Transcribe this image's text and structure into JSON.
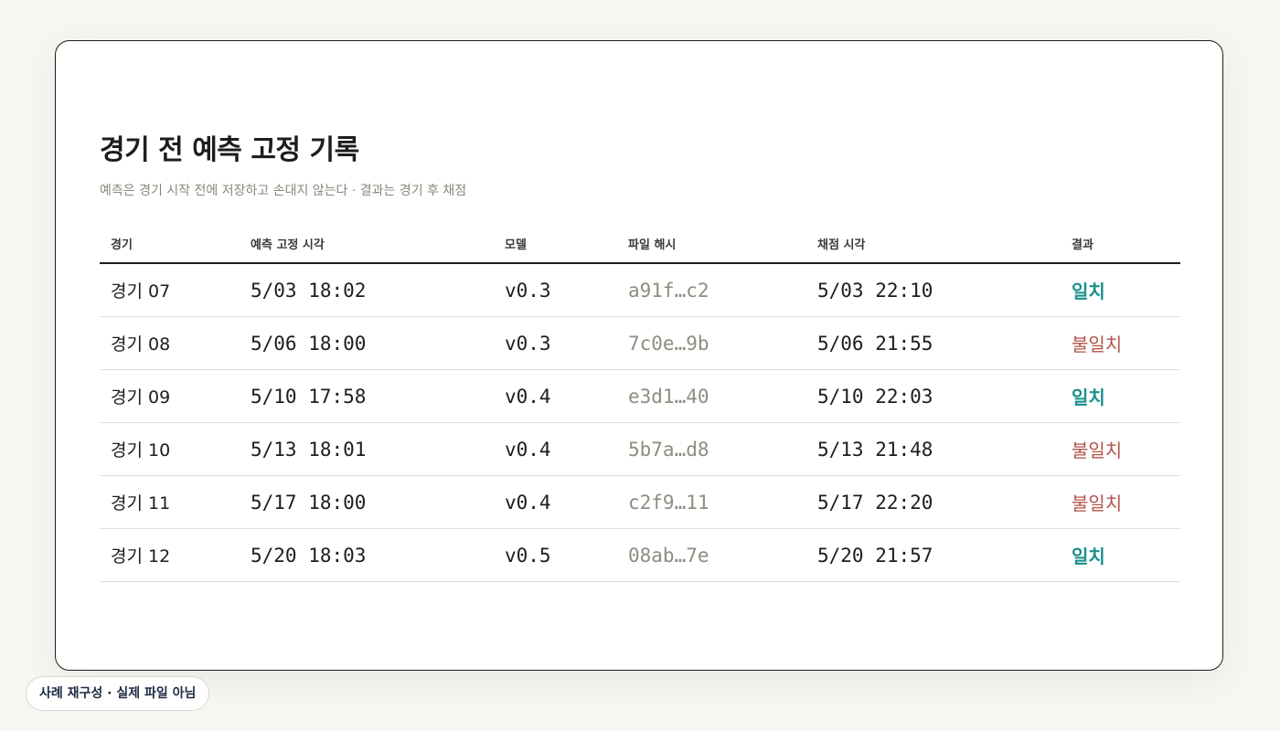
{
  "page": {
    "title": "경기 전 예측 고정 기록",
    "subtitle": "예측은 경기 시작 전에 저장하고 손대지 않는다 · 결과는 경기 후 채점"
  },
  "table": {
    "headers": [
      "경기",
      "예측 고정 시각",
      "모델",
      "파일 해시",
      "채점 시각",
      "결과"
    ],
    "rows": [
      {
        "game": "경기 07",
        "locked_at": "5/03 18:02",
        "model": "v0.3",
        "hash": "a91f…c2",
        "scored_at": "5/03 22:10",
        "result": "일치",
        "status": "match"
      },
      {
        "game": "경기 08",
        "locked_at": "5/06 18:00",
        "model": "v0.3",
        "hash": "7c0e…9b",
        "scored_at": "5/06 21:55",
        "result": "불일치",
        "status": "mismatch"
      },
      {
        "game": "경기 09",
        "locked_at": "5/10 17:58",
        "model": "v0.4",
        "hash": "e3d1…40",
        "scored_at": "5/10 22:03",
        "result": "일치",
        "status": "match"
      },
      {
        "game": "경기 10",
        "locked_at": "5/13 18:01",
        "model": "v0.4",
        "hash": "5b7a…d8",
        "scored_at": "5/13 21:48",
        "result": "불일치",
        "status": "mismatch"
      },
      {
        "game": "경기 11",
        "locked_at": "5/17 18:00",
        "model": "v0.4",
        "hash": "c2f9…11",
        "scored_at": "5/17 22:20",
        "result": "불일치",
        "status": "mismatch"
      },
      {
        "game": "경기 12",
        "locked_at": "5/20 18:03",
        "model": "v0.5",
        "hash": "08ab…7e",
        "scored_at": "5/20 21:57",
        "result": "일치",
        "status": "match"
      }
    ]
  },
  "colors": {
    "match": "#1a8f8c",
    "mismatch": "#b3524a",
    "hash": "#8f8c80",
    "background": "#f7f6f1"
  },
  "footer": {
    "badge": "사례 재구성 · 실제 파일 아님"
  }
}
